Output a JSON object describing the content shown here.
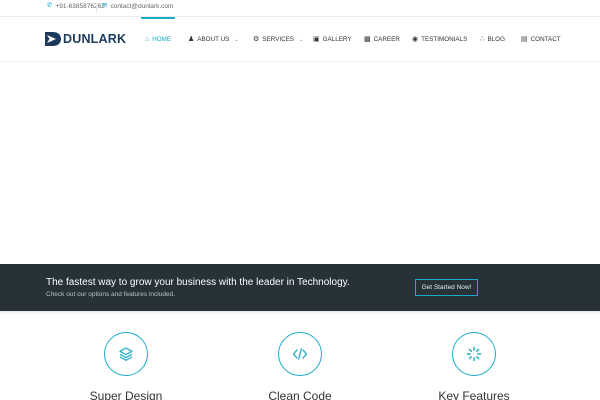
{
  "topbar": {
    "phone": "+91-6385876262",
    "email": "contact@dunlark.com"
  },
  "brand": {
    "name": "DUNLARK",
    "colors": {
      "accent": "#1aabc7",
      "logo": "#1b3a5c",
      "band": "#263238"
    }
  },
  "nav": {
    "active": "home",
    "items": [
      {
        "id": "home",
        "label": "HOME",
        "icon": "home-icon"
      },
      {
        "id": "about",
        "label": "ABOUT US",
        "icon": "users-icon",
        "dropdown": true
      },
      {
        "id": "services",
        "label": "SERVICES",
        "icon": "cogs-icon",
        "dropdown": true
      },
      {
        "id": "gallery",
        "label": "GALLERY",
        "icon": "camera-icon"
      },
      {
        "id": "career",
        "label": "CAREER",
        "icon": "briefcase-icon"
      },
      {
        "id": "testimonials",
        "label": "TESTIMONIALS",
        "icon": "comments-icon"
      },
      {
        "id": "blog",
        "label": "BLOG",
        "icon": "rss-icon"
      },
      {
        "id": "contact",
        "label": "CONTACT",
        "icon": "contact-card-icon"
      }
    ]
  },
  "callout": {
    "headline": "The fastest way to grow your business with the leader in Technology.",
    "subtext": "Check out our options and features included.",
    "button_label": "Get Started Now!"
  },
  "features": [
    {
      "title": "Super Design",
      "icon": "layers-icon"
    },
    {
      "title": "Clean Code",
      "icon": "code-icon"
    },
    {
      "title": "Key Features",
      "icon": "spinner-icon"
    }
  ]
}
